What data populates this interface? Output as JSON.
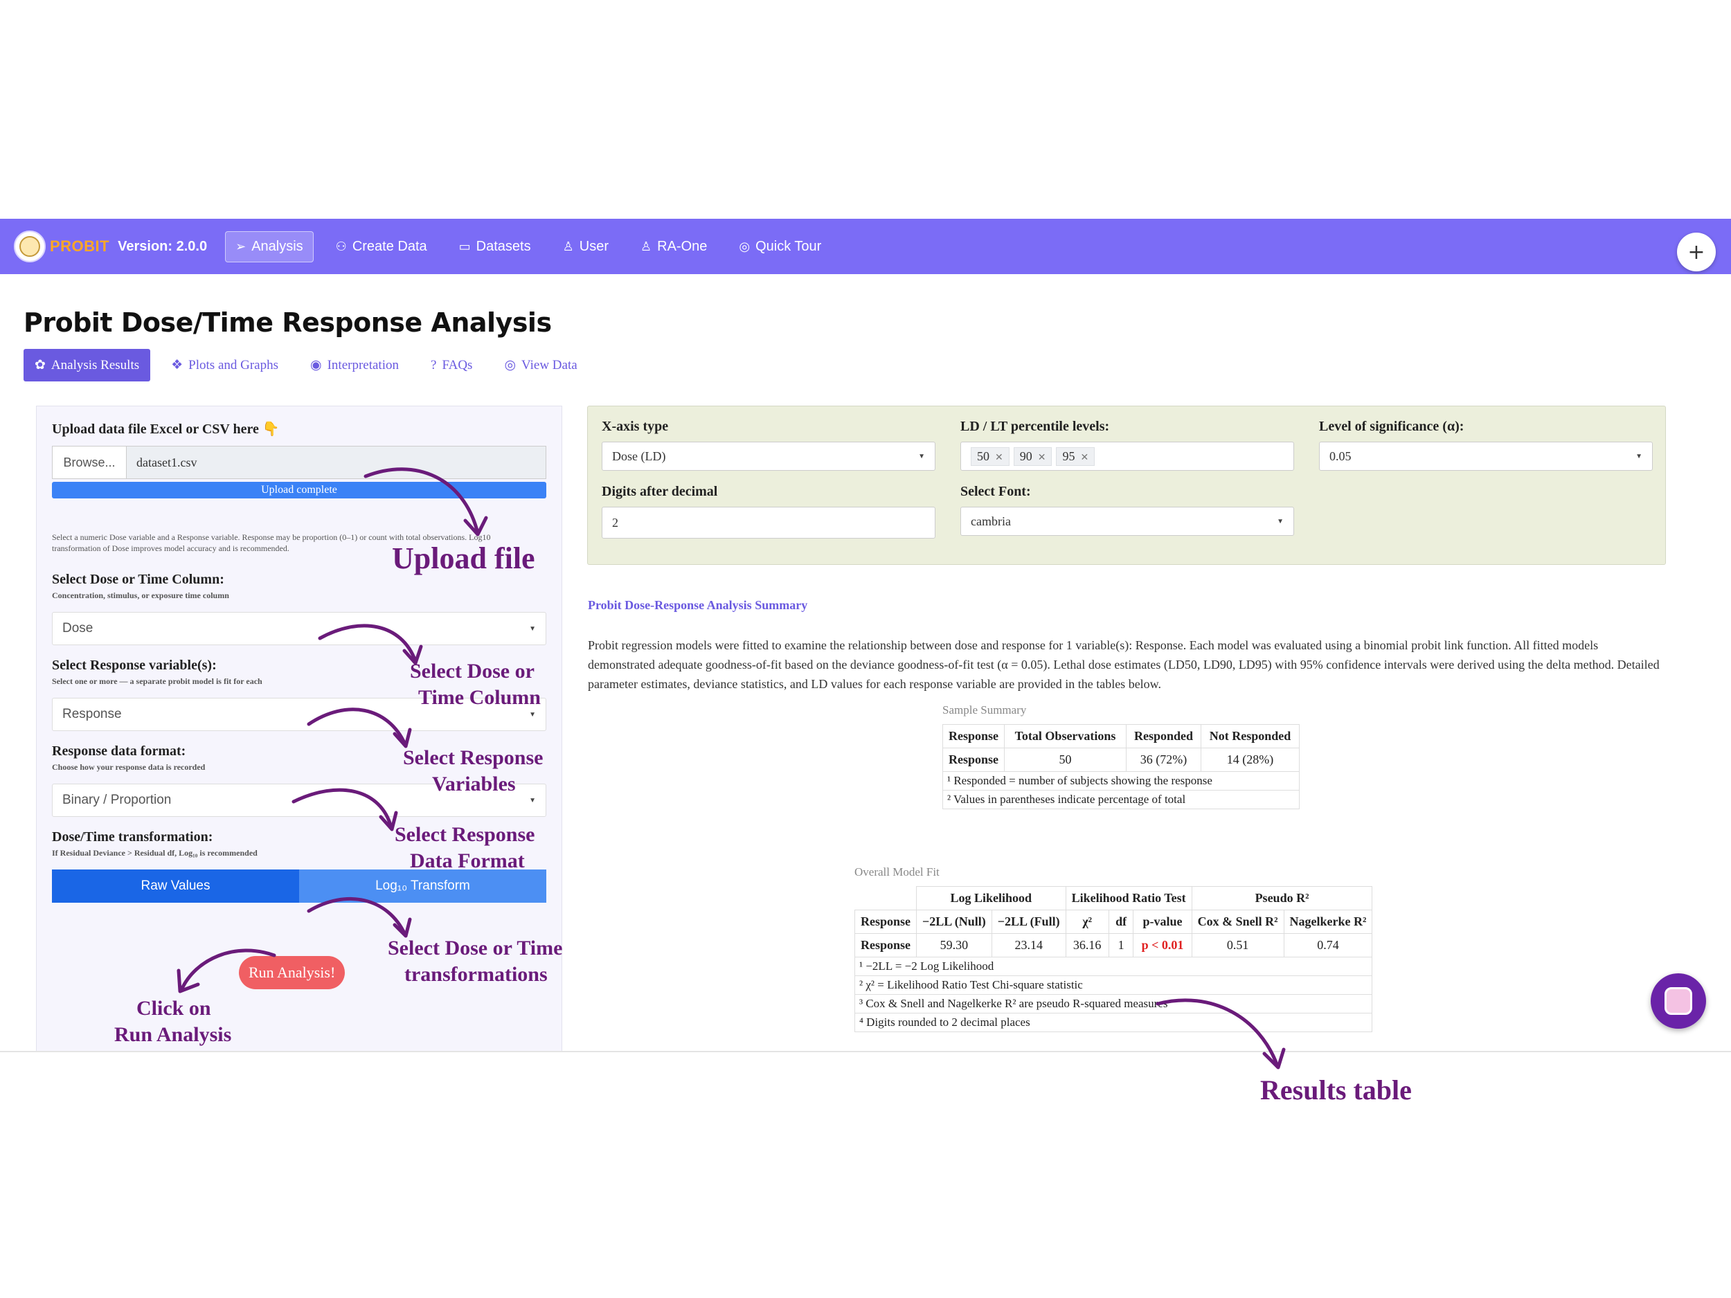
{
  "navbar": {
    "brand": "PROBIT",
    "version": "Version: 2.0.0",
    "items": [
      {
        "label": "Analysis",
        "icon": "paper-plane-icon",
        "active": true
      },
      {
        "label": "Create Data",
        "icon": "binoculars-icon",
        "active": false
      },
      {
        "label": "Datasets",
        "icon": "folder-open-icon",
        "active": false
      },
      {
        "label": "User",
        "icon": "user-icon",
        "active": false
      },
      {
        "label": "RA-One",
        "icon": "user-icon",
        "active": false
      },
      {
        "label": "Quick Tour",
        "icon": "compass-icon",
        "active": false
      }
    ],
    "plus_label": "+"
  },
  "page": {
    "title": "Probit Dose/Time Response Analysis",
    "tabs": [
      {
        "label": "Analysis Results",
        "icon": "brain-icon",
        "active": true
      },
      {
        "label": "Plots and Graphs",
        "icon": "cubes-icon",
        "active": false
      },
      {
        "label": "Interpretation",
        "icon": "compass-icon",
        "active": false
      },
      {
        "label": "FAQs",
        "icon": "question-icon",
        "active": false
      },
      {
        "label": "View Data",
        "icon": "eye-icon",
        "active": false
      }
    ]
  },
  "sidebar": {
    "upload_label": "Upload data file Excel or CSV here 👇",
    "browse_label": "Browse...",
    "file_name": "dataset1.csv",
    "upload_status": "Upload complete",
    "upload_progress": 1.0,
    "help_text": "Select a numeric Dose variable and a Response variable. Response may be proportion (0–1) or count with total observations. Log10 transformation of Dose improves model accuracy and is recommended.",
    "dose_label": "Select Dose or Time Column:",
    "dose_sub": "Concentration, stimulus, or exposure time column",
    "dose_value": "Dose",
    "response_label": "Select Response variable(s):",
    "response_sub": "Select one or more — a separate probit model is fit for each",
    "response_value": "Response",
    "format_label": "Response data format:",
    "format_sub": "Choose how your response data is recorded",
    "format_value": "Binary / Proportion",
    "transform_label": "Dose/Time transformation:",
    "transform_sub": "If Residual Deviance > Residual df, Log₁₀ is recommended",
    "transform_options": [
      "Raw Values",
      "Log₁₀ Transform"
    ],
    "run_label": "Run Analysis!"
  },
  "settings": {
    "xaxis_label": "X-axis type",
    "xaxis_value": "Dose (LD)",
    "ld_label": "LD / LT percentile levels:",
    "ld_values": [
      "50",
      "90",
      "95"
    ],
    "alpha_label": "Level of significance (α):",
    "alpha_value": "0.05",
    "digits_label": "Digits after decimal",
    "digits_value": "2",
    "font_label": "Select Font:",
    "font_value": "cambria"
  },
  "summary": {
    "heading": "Probit Dose-Response Analysis Summary",
    "text": "Probit regression models were fitted to examine the relationship between dose and response for 1 variable(s): Response. Each model was evaluated using a binomial probit link function. All fitted models demonstrated adequate goodness-of-fit based on the deviance goodness-of-fit test (α = 0.05). Lethal dose estimates (LD50, LD90, LD95) with 95% confidence intervals were derived using the delta method. Detailed parameter estimates, deviance statistics, and LD values for each response variable are provided in the tables below."
  },
  "sample_summary": {
    "caption": "Sample Summary",
    "headers": [
      "Response",
      "Total Observations",
      "Responded",
      "Not Responded"
    ],
    "row": [
      "Response",
      "50",
      "36 (72%)",
      "14 (28%)"
    ],
    "footnotes": [
      "¹ Responded = number of subjects showing the response",
      "² Values in parentheses indicate percentage of total"
    ]
  },
  "model_fit": {
    "caption": "Overall Model Fit",
    "groups": [
      "Log Likelihood",
      "Likelihood Ratio Test",
      "Pseudo R²"
    ],
    "headers": [
      "Response",
      "−2LL (Null)",
      "−2LL (Full)",
      "χ²",
      "df",
      "p-value",
      "Cox & Snell R²",
      "Nagelkerke R²"
    ],
    "row": [
      "Response",
      "59.30",
      "23.14",
      "36.16",
      "1",
      "p < 0.01",
      "0.51",
      "0.74"
    ],
    "footnotes": [
      "¹ −2LL = −2 Log Likelihood",
      "² χ² = Likelihood Ratio Test Chi-square statistic",
      "³ Cox & Snell and Nagelkerke R² are pseudo R-squared measures",
      "⁴ Digits rounded to 2 decimal places"
    ]
  },
  "annotations": {
    "upload": "Upload file",
    "dose_1": "Select Dose or",
    "dose_2": "Time Column",
    "resp_1": "Select Response",
    "resp_2": "Variables",
    "fmt_1": "Select Response",
    "fmt_2": "Data Format",
    "trans_1": "Select Dose or Time",
    "trans_2": "transformations",
    "click_1": "Click on",
    "click_2": "Run Analysis",
    "results": "Results table"
  },
  "colors": {
    "navbar": "#7b6cf6",
    "accent": "#6a5ae0",
    "annotation": "#6a1b7a",
    "run_button": "#f05f63",
    "significant": "#e02020"
  }
}
